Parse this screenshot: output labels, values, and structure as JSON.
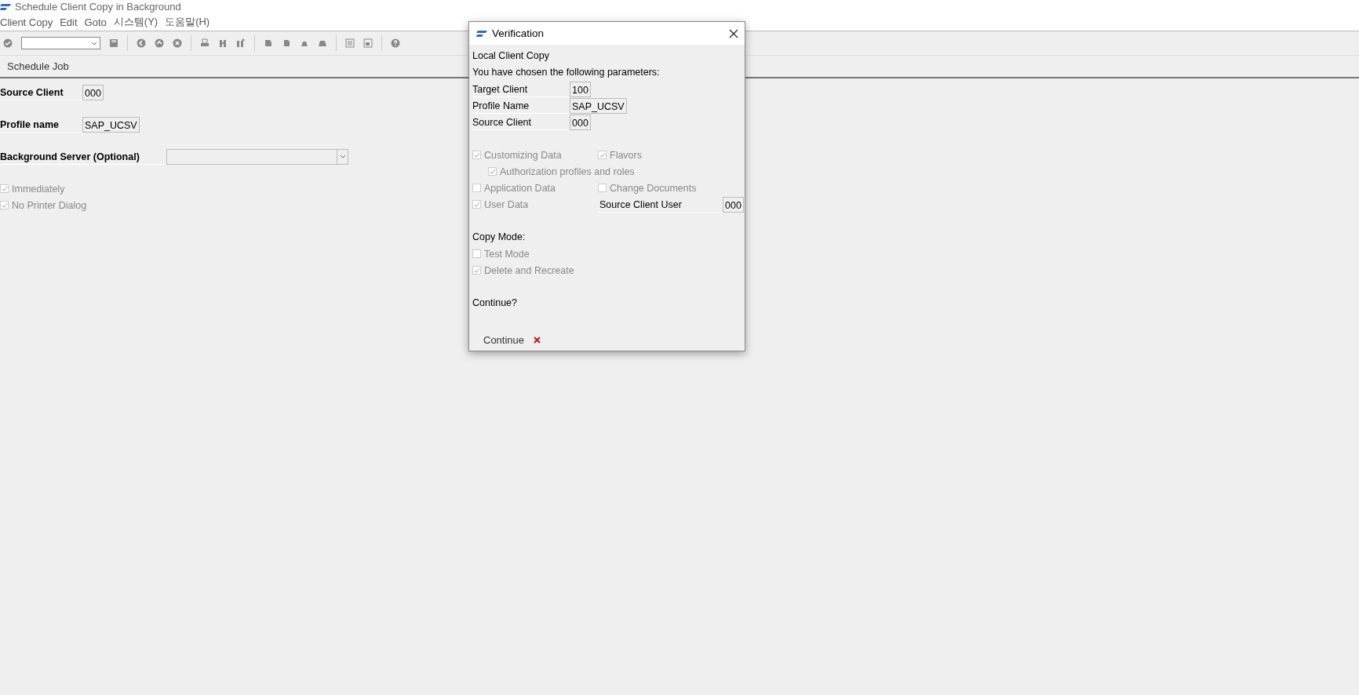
{
  "window": {
    "title": "Schedule Client Copy in Background"
  },
  "menu": [
    {
      "label": "Client Copy"
    },
    {
      "label": "Edit"
    },
    {
      "label": "Goto"
    },
    {
      "label": "시스템(Y)"
    },
    {
      "label": "도움말(H)"
    }
  ],
  "toolbar": {
    "items": [
      {
        "kind": "check"
      },
      {
        "kind": "field"
      },
      {
        "kind": "save"
      },
      {
        "kind": "sep"
      },
      {
        "kind": "back"
      },
      {
        "kind": "exit"
      },
      {
        "kind": "cancel"
      },
      {
        "kind": "sep"
      },
      {
        "kind": "print"
      },
      {
        "kind": "find"
      },
      {
        "kind": "findnext"
      },
      {
        "kind": "sep"
      },
      {
        "kind": "first"
      },
      {
        "kind": "prev"
      },
      {
        "kind": "next"
      },
      {
        "kind": "last"
      },
      {
        "kind": "sep"
      },
      {
        "kind": "window"
      },
      {
        "kind": "window2"
      },
      {
        "kind": "sep"
      },
      {
        "kind": "help"
      }
    ]
  },
  "app_toolbar": {
    "buttons": [
      {
        "label": "Schedule Job"
      }
    ]
  },
  "form": {
    "fields": [
      {
        "label": "Source Client",
        "value": "000",
        "kind": "short"
      },
      {
        "label": "Profile name",
        "value": "SAP_UCSV",
        "kind": "short"
      },
      {
        "label": "Background Server (Optional)",
        "kind": "dropdown"
      }
    ],
    "checkboxes": [
      {
        "label": "Immediately",
        "checked": true,
        "disabled": true
      },
      {
        "label": "No Printer Dialog",
        "checked": true,
        "disabled": true
      }
    ]
  },
  "dialog": {
    "title": "Verification",
    "heading": "Local Client Copy",
    "intro": "You have chosen the following parameters:",
    "fields": [
      {
        "label": "Target Client",
        "value": "100"
      },
      {
        "label": "Profile Name",
        "value": "SAP_UCSV"
      },
      {
        "label": "Source Client",
        "value": "000"
      }
    ],
    "option_rows": [
      {
        "items": [
          {
            "kind": "checkbox",
            "label": "Customizing Data",
            "checked": true,
            "disabled": true
          },
          {
            "kind": "checkbox",
            "label": "Flavors",
            "checked": true,
            "disabled": true
          }
        ]
      },
      {
        "items": [
          {
            "kind": "subcheckbox",
            "label": "Authorization profiles and roles",
            "checked": true,
            "disabled": true
          }
        ]
      },
      {
        "items": [
          {
            "kind": "checkbox",
            "label": "Application Data",
            "checked": false,
            "disabled": true
          },
          {
            "kind": "checkbox",
            "label": "Change Documents",
            "checked": false,
            "disabled": true
          }
        ]
      },
      {
        "items": [
          {
            "kind": "checkbox",
            "label": "User Data",
            "checked": true,
            "disabled": true
          },
          {
            "kind": "field",
            "label": "Source Client User",
            "value": "000"
          }
        ]
      }
    ],
    "copy_mode": {
      "label": "Copy Mode:",
      "options": [
        {
          "label": "Test Mode",
          "checked": false,
          "disabled": true
        },
        {
          "label": "Delete and Recreate",
          "checked": true,
          "disabled": true
        }
      ]
    },
    "question": "Continue?",
    "buttons": [
      {
        "kind": "text",
        "label": "Continue"
      },
      {
        "kind": "cancel"
      }
    ]
  }
}
